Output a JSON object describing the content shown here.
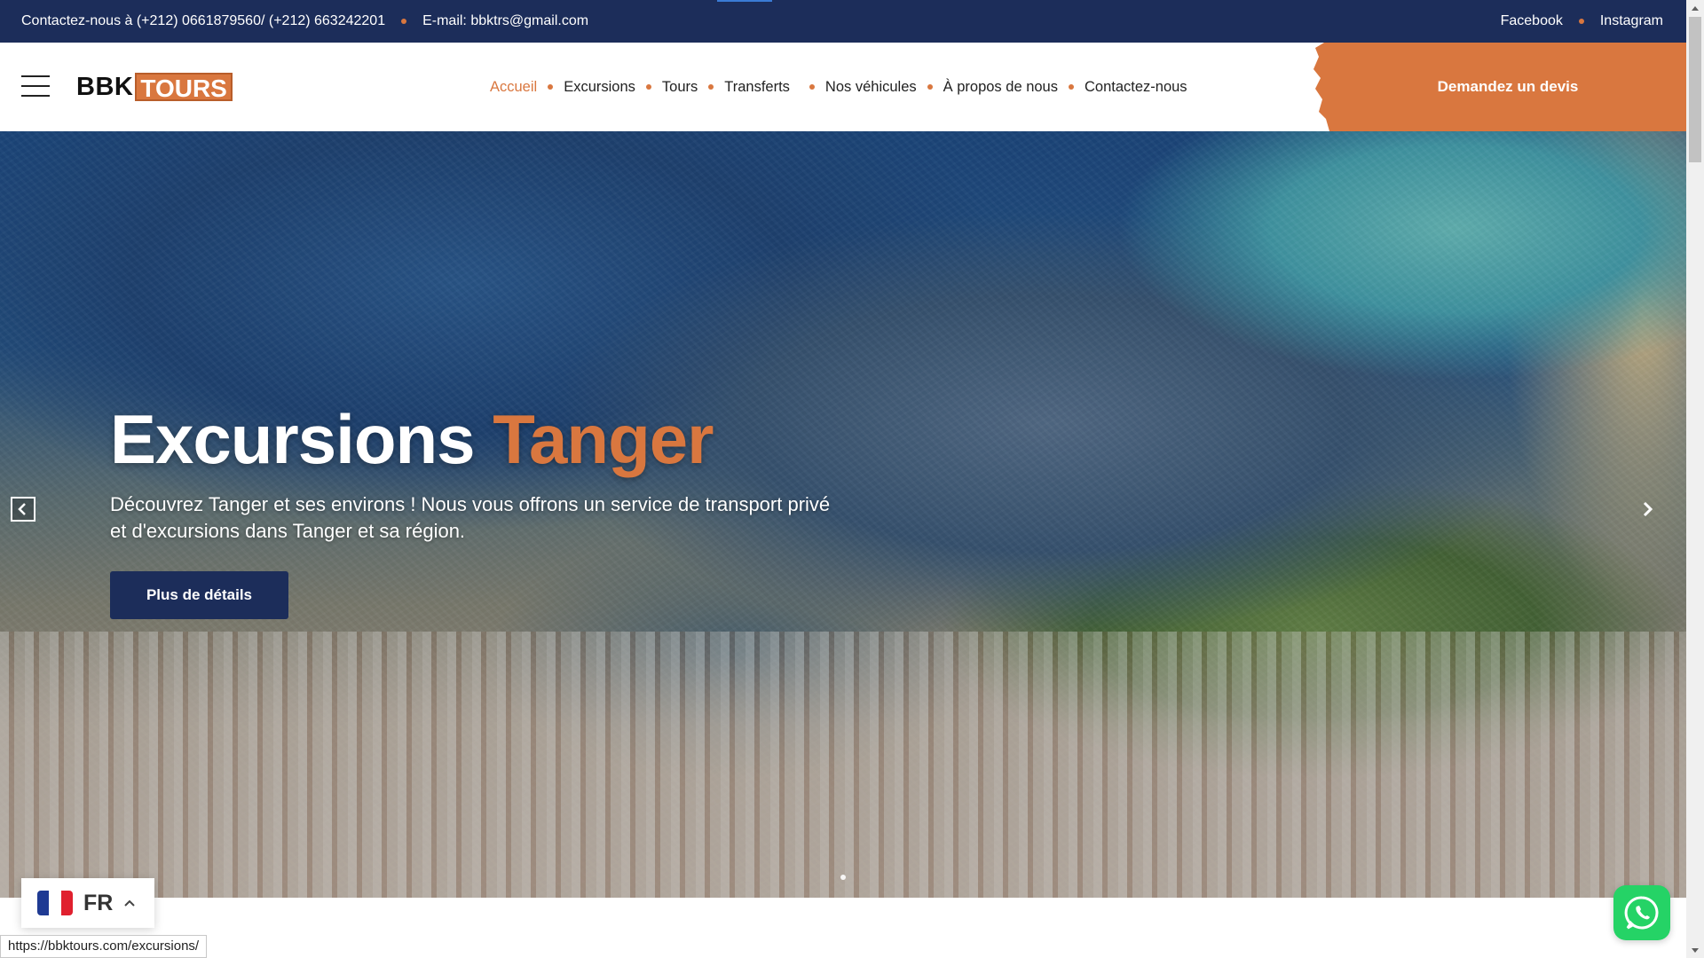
{
  "topbar": {
    "contact": "Contactez-nous à (+212) 0661879560/ (+212) 663242201",
    "email": "E-mail: bbktrs@gmail.com",
    "social": [
      "Facebook",
      "Instagram"
    ]
  },
  "header": {
    "logo_left": "BBK",
    "logo_right": "TOURS",
    "nav": [
      "Accueil",
      "Excursions",
      "Tours",
      "Transferts",
      "Nos véhicules",
      "À propos de nous",
      "Contactez-nous"
    ],
    "active_nav": "Accueil",
    "cta_label": "Demandez un devis"
  },
  "hero": {
    "title_part1": "Excursions",
    "title_part2": "Tanger",
    "subtitle": "Découvrez Tanger et ses environs ! Nous vous offrons un service de transport privé et d'excursions dans Tanger et sa région.",
    "button_label": "Plus de détails"
  },
  "language": {
    "code": "FR"
  },
  "status_url": "https://bbktours.com/excursions/",
  "icons": {
    "menu": "hamburger-icon",
    "prev": "chevron-left-icon",
    "next": "chevron-right-icon",
    "chat": "whatsapp-icon",
    "lang_toggle": "chevron-up-icon"
  },
  "colors": {
    "navy": "#1c2d5a",
    "accent": "#d9773f",
    "whatsapp": "#25d366"
  }
}
